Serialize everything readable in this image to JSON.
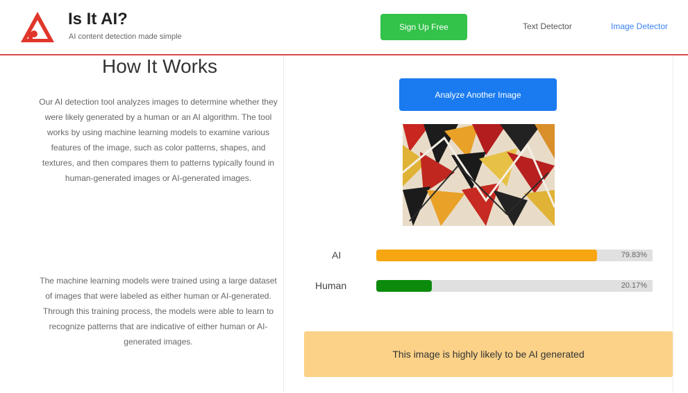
{
  "header": {
    "title": "Is It AI?",
    "subtitle": "AI content detection made simple",
    "signup_label": "Sign Up Free",
    "nav": {
      "text_detector": "Text Detector",
      "image_detector": "Image Detector"
    },
    "colors": {
      "accent": "#d94848",
      "signup": "#33c24a",
      "link": "#3b82f6"
    }
  },
  "how_it_works": {
    "title": "How It Works",
    "paragraph1": "Our AI detection tool analyzes images to determine whether they were likely generated by a human or an AI algorithm. The tool works by using machine learning models to examine various features of the image, such as color patterns, shapes, and textures, and then compares them to patterns typically found in human-generated images or AI-generated images.",
    "paragraph2": "The machine learning models were trained using a large dataset of images that were labeled as either human or AI-generated. Through this training process, the models were able to learn to recognize patterns that are indicative of either human or AI-generated images."
  },
  "result": {
    "analyze_label": "Analyze Another Image",
    "image_icon": "abstract-art-image",
    "ai": {
      "label": "AI",
      "value_text": "79.83%",
      "fraction": 0.7983
    },
    "human": {
      "label": "Human",
      "value_text": "20.17%",
      "fraction": 0.2017
    },
    "verdict": "This image is highly likely to be AI generated",
    "colors": {
      "ai_bar": "#f7a611",
      "human_bar": "#0c8a0c",
      "verdict_bg": "#fbd288",
      "button": "#1a7bf0"
    }
  }
}
